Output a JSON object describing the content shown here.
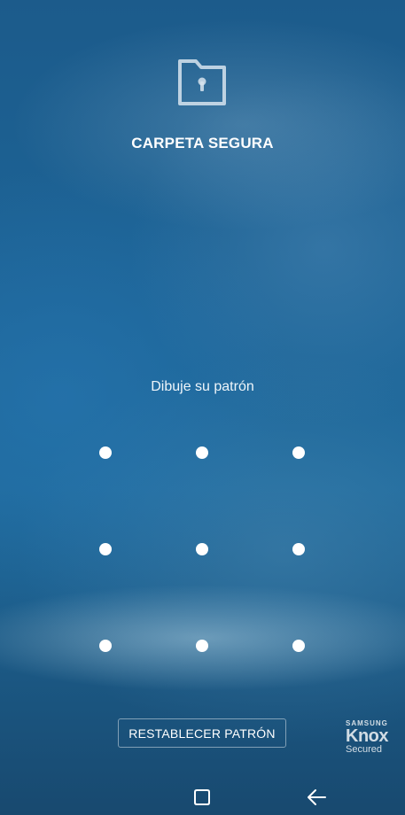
{
  "header": {
    "icon": "secure-folder-lock-icon",
    "title": "CARPETA SEGURA"
  },
  "pattern": {
    "prompt": "Dibuje su patrón",
    "dot_count": 9
  },
  "actions": {
    "reset_label": "RESTABLECER PATRÓN"
  },
  "badge": {
    "brand": "SAMSUNG",
    "name": "Knox",
    "subtitle": "Secured"
  },
  "navbar": {
    "recents_icon": "recents-icon",
    "back_icon": "back-arrow-icon"
  },
  "colors": {
    "background": "#1f5f90",
    "text": "#ffffff"
  }
}
